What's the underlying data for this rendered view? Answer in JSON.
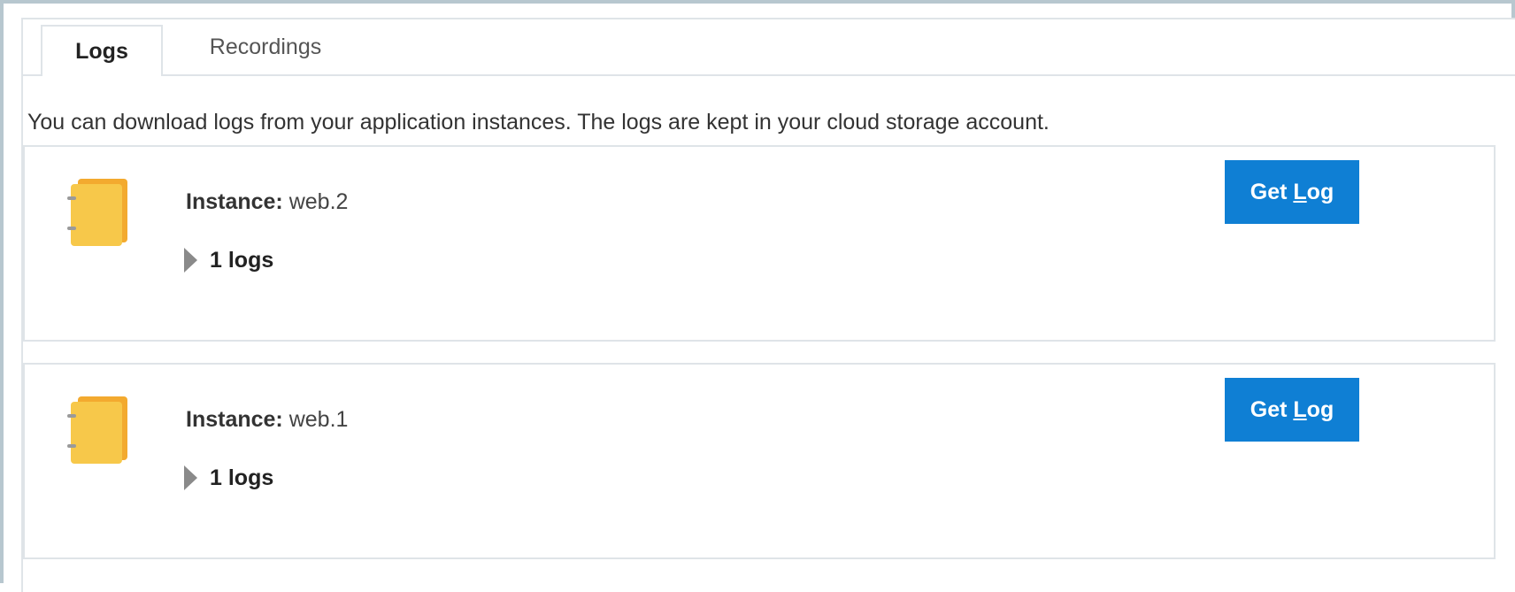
{
  "tabs": [
    {
      "label": "Logs",
      "selected": true
    },
    {
      "label": "Recordings",
      "selected": false
    }
  ],
  "description": "You can download logs from your application instances. The logs are kept in your cloud storage account.",
  "instances": [
    {
      "label": "Instance:",
      "name": "web.2",
      "logs_label": "1 logs",
      "button_pre": "Get ",
      "button_key": "L",
      "button_post": "og"
    },
    {
      "label": "Instance:",
      "name": "web.1",
      "logs_label": "1 logs",
      "button_pre": "Get ",
      "button_key": "L",
      "button_post": "og"
    }
  ],
  "colors": {
    "accent": "#0f7fd4",
    "icon_fill": "#f7c84a",
    "icon_back": "#f3aa2f",
    "border": "#dfe4e8",
    "frame": "#b7c7cf"
  },
  "icons": {
    "instance_icon": "notebook-icon",
    "expand_icon": "triangle-right-icon"
  }
}
